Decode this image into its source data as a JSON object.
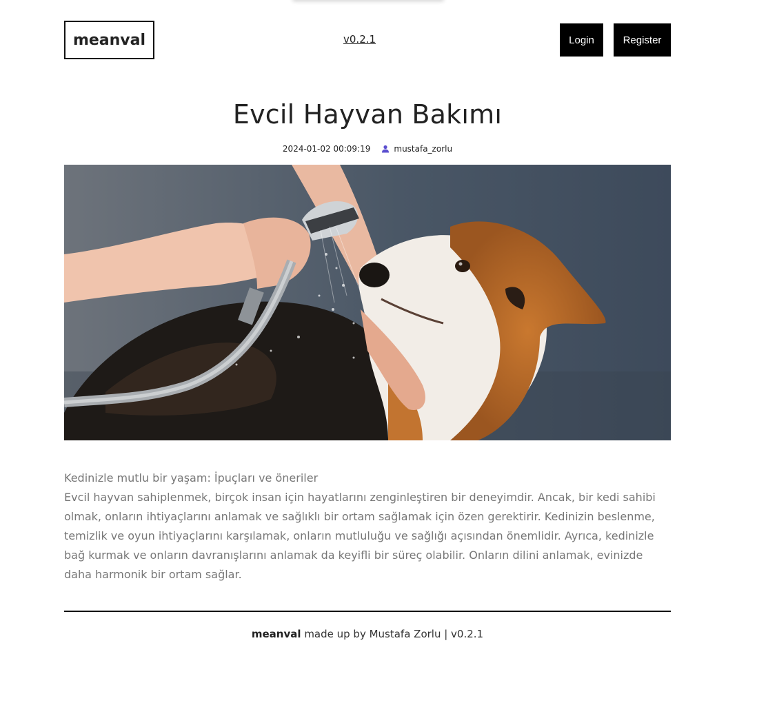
{
  "header": {
    "logo": "meanval",
    "version": "v0.2.1",
    "login_label": "Login",
    "register_label": "Register"
  },
  "post": {
    "title": "Evcil Hayvan Bakımı",
    "date": "2024-01-02 00:09:19",
    "author": "mustafa_zorlu",
    "subtitle": "Kedinizle mutlu bir yaşam: İpuçları ve öneriler",
    "body": "Evcil hayvan sahiplenmek, birçok insan için hayatlarını zenginleştiren bir deneyimdir. Ancak, bir kedi sahibi olmak, onların ihtiyaçlarını anlamak ve sağlıklı bir ortam sağlamak için özen gerektirir. Kedinizin beslenme, temizlik ve oyun ihtiyaçlarını karşılamak, onların mutluluğu ve sağlığı açısından önemlidir. Ayrıca, kedinizle bağ kurmak ve onların davranışlarını anlamak da keyifli bir süreç olabilir. Onların dilini anlamak, evinizde daha harmonik bir ortam sağlar."
  },
  "footer": {
    "brand": "meanval",
    "credit": "made up by Mustafa Zorlu | v0.2.1"
  },
  "colors": {
    "accent_icon": "#5b4fcf",
    "button_bg": "#000000",
    "body_text": "#777777"
  },
  "icons": {
    "author": "user-icon"
  }
}
